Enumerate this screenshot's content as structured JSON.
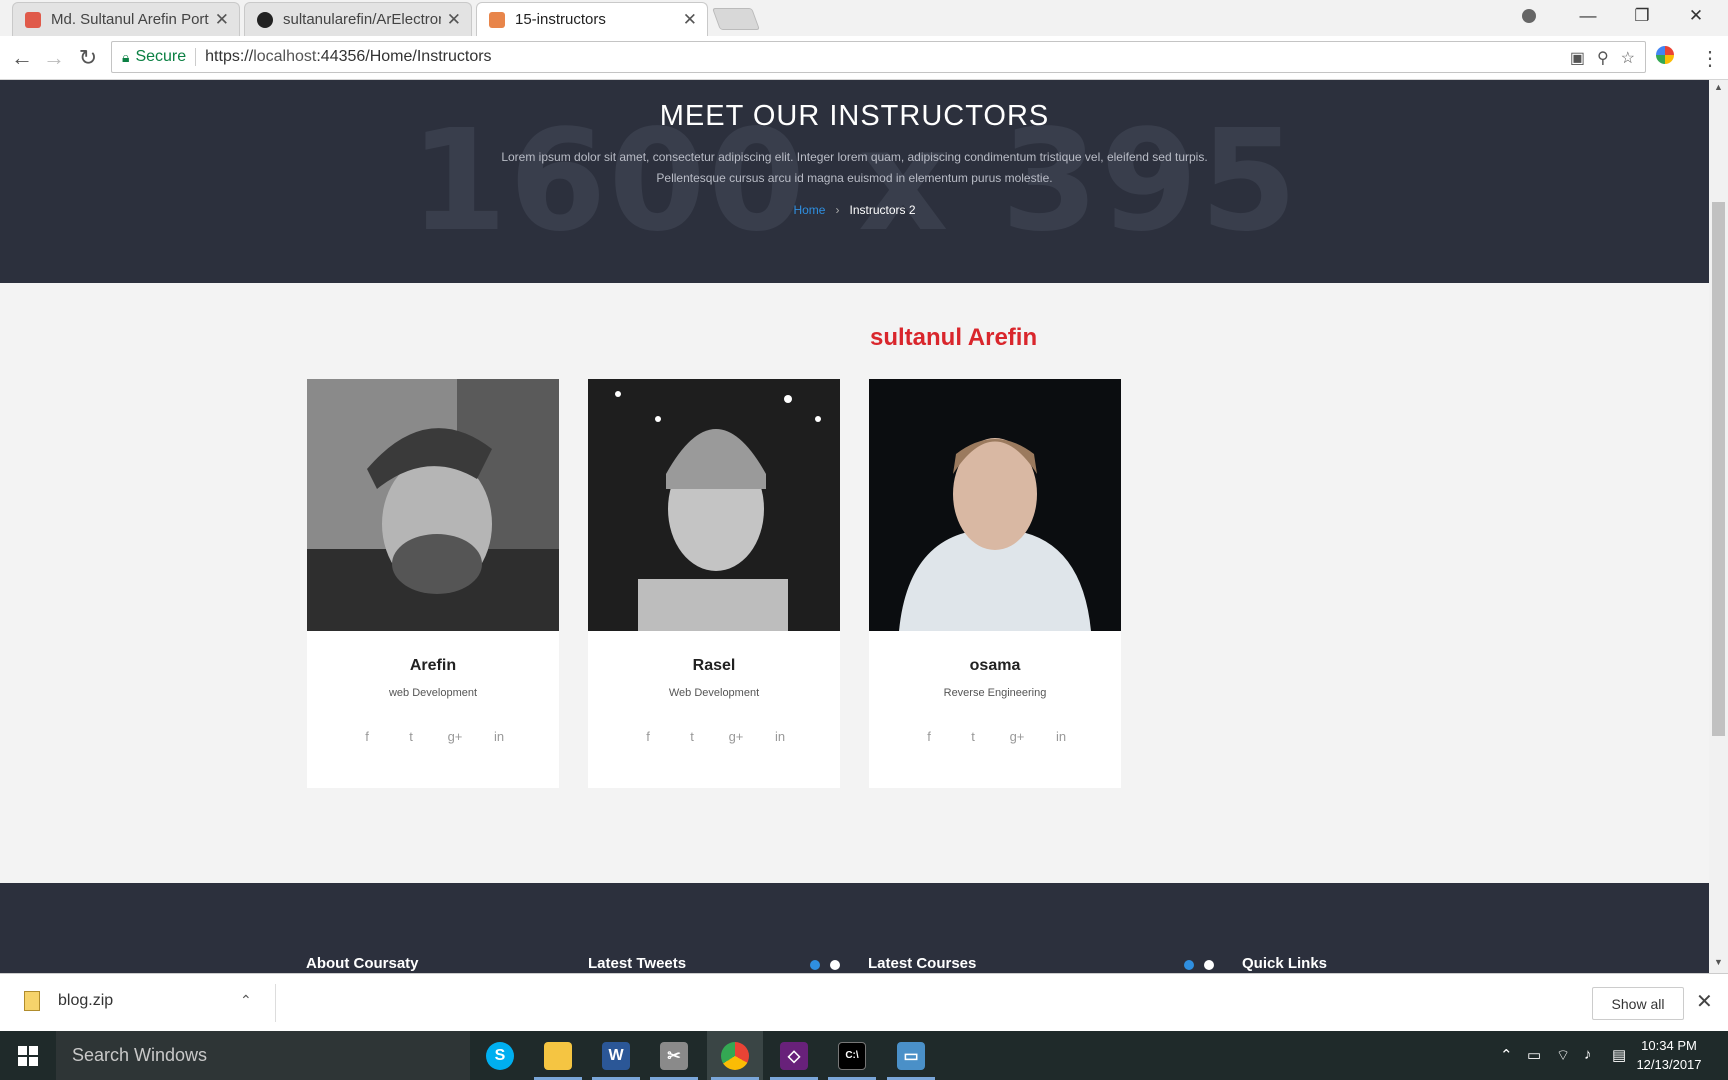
{
  "browser": {
    "tabs": [
      {
        "title": "Md. Sultanul Arefin Portf",
        "favicon_color": "#e05a4a"
      },
      {
        "title": "sultanularefin/ArElectron",
        "favicon_color": "#222222"
      },
      {
        "title": "15-instructors",
        "favicon_color": "#e8854a",
        "active": true
      }
    ],
    "secure_label": "Secure",
    "url_scheme": "https://",
    "url_host": "localhost",
    "url_rest": ":44356/Home/Instructors"
  },
  "hero": {
    "watermark": "1600 x 395",
    "title": "MEET OUR INSTRUCTORS",
    "description_line1": "Lorem ipsum dolor sit amet, consectetur adipiscing elit. Integer lorem quam, adipiscing condimentum tristique vel, eleifend sed turpis.",
    "description_line2": "Pellentesque cursus arcu id magna euismod in elementum purus molestie.",
    "breadcrumb_home": "Home",
    "breadcrumb_current": "Instructors 2"
  },
  "signature": "sultanul Arefin",
  "instructors": [
    {
      "name": "Arefin",
      "role": "web Development"
    },
    {
      "name": "Rasel",
      "role": "Web Development"
    },
    {
      "name": "osama",
      "role": "Reverse Engineering"
    }
  ],
  "social_icons": [
    "f",
    "t",
    "g+",
    "in"
  ],
  "footer": {
    "col1": "About Coursaty",
    "col2": "Latest Tweets",
    "col3": "Latest Courses",
    "col4": "Quick Links",
    "accent_color": "#2f8fe0"
  },
  "downloads": {
    "file_name": "blog.zip",
    "show_all": "Show all"
  },
  "taskbar": {
    "search_placeholder": "Search Windows",
    "time": "10:34 PM",
    "date": "12/13/2017"
  }
}
